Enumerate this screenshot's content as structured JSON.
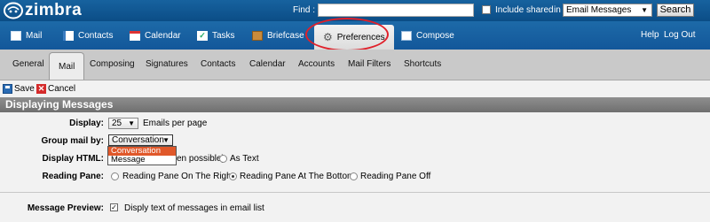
{
  "app": {
    "logo_text": "zimbra"
  },
  "search": {
    "find_label": "Find :",
    "query": "",
    "include_shared_label": "Include shared",
    "include_shared_checked": false,
    "in_label": "in",
    "scope_value": "Email Messages",
    "search_button": "Search"
  },
  "app_tabs": [
    {
      "label": "Mail",
      "icon": "mail-icon"
    },
    {
      "label": "Contacts",
      "icon": "contacts-icon"
    },
    {
      "label": "Calendar",
      "icon": "calendar-icon"
    },
    {
      "label": "Tasks",
      "icon": "tasks-icon"
    },
    {
      "label": "Briefcase",
      "icon": "briefcase-icon"
    },
    {
      "label": "Preferences",
      "icon": "gear-icon",
      "active": true
    },
    {
      "label": "Compose",
      "icon": "compose-icon"
    }
  ],
  "header_links": {
    "help": "Help",
    "logout": "Log Out"
  },
  "settings_tabs": [
    {
      "label": "General"
    },
    {
      "label": "Mail",
      "active": true
    },
    {
      "label": "Composing"
    },
    {
      "label": "Signatures"
    },
    {
      "label": "Contacts"
    },
    {
      "label": "Calendar"
    },
    {
      "label": "Accounts"
    },
    {
      "label": "Mail Filters"
    },
    {
      "label": "Shortcuts"
    }
  ],
  "toolbar": {
    "save": "Save",
    "cancel": "Cancel"
  },
  "section": {
    "title": "Displaying Messages",
    "display": {
      "label": "Display:",
      "value": "25",
      "suffix": "Emails per page"
    },
    "group_by": {
      "label": "Group mail by:",
      "value": "Conversation",
      "options": [
        "Conversation",
        "Message"
      ],
      "selected_option": "Conversation"
    },
    "display_html": {
      "label": "Display HTML:",
      "option_html_partial": "en possible)",
      "option_text": "As Text",
      "selected": "html"
    },
    "reading_pane": {
      "label": "Reading Pane:",
      "options": [
        "Reading Pane On The Right",
        "Reading Pane At The Bottom",
        "Reading Pane Off"
      ],
      "selected_index": 1
    },
    "message_preview": {
      "label": "Message Preview:",
      "checkbox_label": "Disply text of messages in email list",
      "checked": true
    }
  },
  "colors": {
    "header_blue": "#13579a",
    "highlight_ring": "#e0202a",
    "dropdown_selected": "#e0582a",
    "section_header": "#7a7a7a"
  }
}
